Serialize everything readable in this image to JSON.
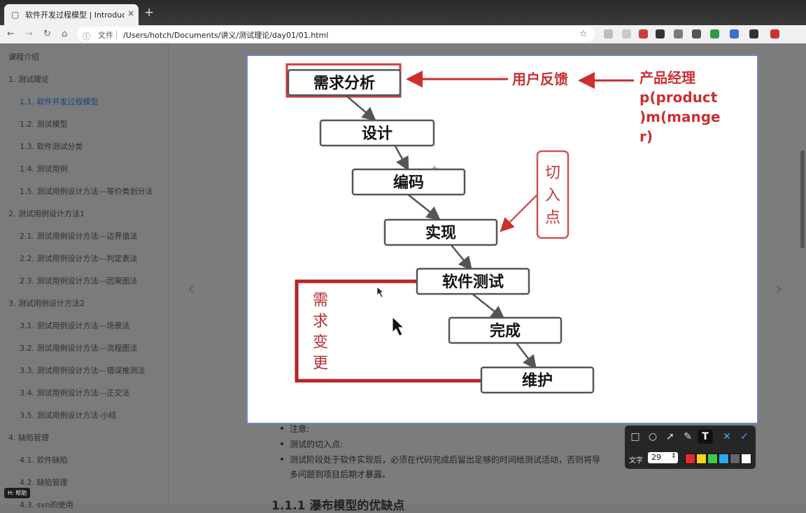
{
  "browser": {
    "tab_title": "软件开发过程模型 | Introductio",
    "tab_icon": "book-icon",
    "close_glyph": "×",
    "newtab_glyph": "+",
    "scheme_label": "文件",
    "url": "/Users/hotch/Documents/讲义/测试理论/day01/01.html",
    "extensions": [
      "#bdbdbd",
      "#c9c9c9",
      "#d23b3b",
      "#333333",
      "#7a7a7a",
      "#555555",
      "#2f9a4a",
      "#3b6fd0",
      "#333333",
      "#cc3333"
    ]
  },
  "sidebar": {
    "items": [
      {
        "label": "课程介绍",
        "level": 0,
        "active": false
      },
      {
        "label": "1. 测试理论",
        "level": 0,
        "active": false
      },
      {
        "label": "1.1. 软件开发过程模型",
        "level": 1,
        "active": true
      },
      {
        "label": "1.2. 测试模型",
        "level": 1,
        "active": false
      },
      {
        "label": "1.3. 软件测试分类",
        "level": 1,
        "active": false
      },
      {
        "label": "1.4. 测试用例",
        "level": 1,
        "active": false
      },
      {
        "label": "1.5. 测试用例设计方法---等价类划分法",
        "level": 1,
        "active": false
      },
      {
        "label": "2. 测试用例设计方法1",
        "level": 0,
        "active": false
      },
      {
        "label": "2.1. 测试用例设计方法---边界值法",
        "level": 1,
        "active": false
      },
      {
        "label": "2.2. 测试用例设计方法---判定表法",
        "level": 1,
        "active": false
      },
      {
        "label": "2.3. 测试用例设计方法---因果图法",
        "level": 1,
        "active": false
      },
      {
        "label": "3. 测试用例设计方法2",
        "level": 0,
        "active": false
      },
      {
        "label": "3.1. 测试用例设计方法---场景法",
        "level": 1,
        "active": false
      },
      {
        "label": "3.2. 测试用例设计方法---流程图法",
        "level": 1,
        "active": false
      },
      {
        "label": "3.3. 测试用例设计方法---错误推测法",
        "level": 1,
        "active": false
      },
      {
        "label": "3.4. 测试用例设计方法---正交法",
        "level": 1,
        "active": false
      },
      {
        "label": "3.5. 测试用例设计方法-小结",
        "level": 1,
        "active": false
      },
      {
        "label": "4. 缺陷管理",
        "level": 0,
        "active": false
      },
      {
        "label": "4.1. 软件缺陷",
        "level": 1,
        "active": false
      },
      {
        "label": "4.2. 缺陷管理",
        "level": 1,
        "active": false
      },
      {
        "label": "4.3. svn的使用",
        "level": 1,
        "active": false
      }
    ]
  },
  "content": {
    "notes": [
      "注意:",
      "测试的切入点:",
      "测试阶段处于软件实现后，必须在代码完成后留出足够的时间给测试活动，否则将导",
      "多问题到项目后期才暴露。"
    ],
    "next_heading": "1.1.1 瀑布模型的优缺点",
    "prev_glyph": "‹",
    "next_glyph": "›"
  },
  "diagram": {
    "steps": [
      "需求分析",
      "设计",
      "编码",
      "实现",
      "软件测试",
      "完成",
      "维护"
    ],
    "user_feedback": "用户反馈",
    "pm_lines": [
      "产品经理",
      "p(product",
      ")m(mange",
      "r)"
    ],
    "entry_point": [
      "切",
      "入",
      "点"
    ],
    "requirement_change": [
      "需",
      "求",
      "变",
      "更"
    ],
    "accent_color": "#cc2f2f"
  },
  "annotation_toolbar": {
    "tools": [
      {
        "name": "rectangle-tool",
        "glyph": "□"
      },
      {
        "name": "ellipse-tool",
        "glyph": "○"
      },
      {
        "name": "arrow-tool",
        "glyph": "➚"
      },
      {
        "name": "brush-tool",
        "glyph": "✎"
      },
      {
        "name": "text-tool",
        "glyph": "T"
      },
      {
        "name": "cancel-tool",
        "glyph": "✕"
      },
      {
        "name": "confirm-tool",
        "glyph": "✓"
      }
    ],
    "text_label": "文字",
    "font_size": "29",
    "colors": [
      "#e52b2b",
      "#f2d21a",
      "#3dc94b",
      "#2ea6e8",
      "#666666",
      "#ffffff"
    ]
  },
  "help_badge": "H: 帮助"
}
